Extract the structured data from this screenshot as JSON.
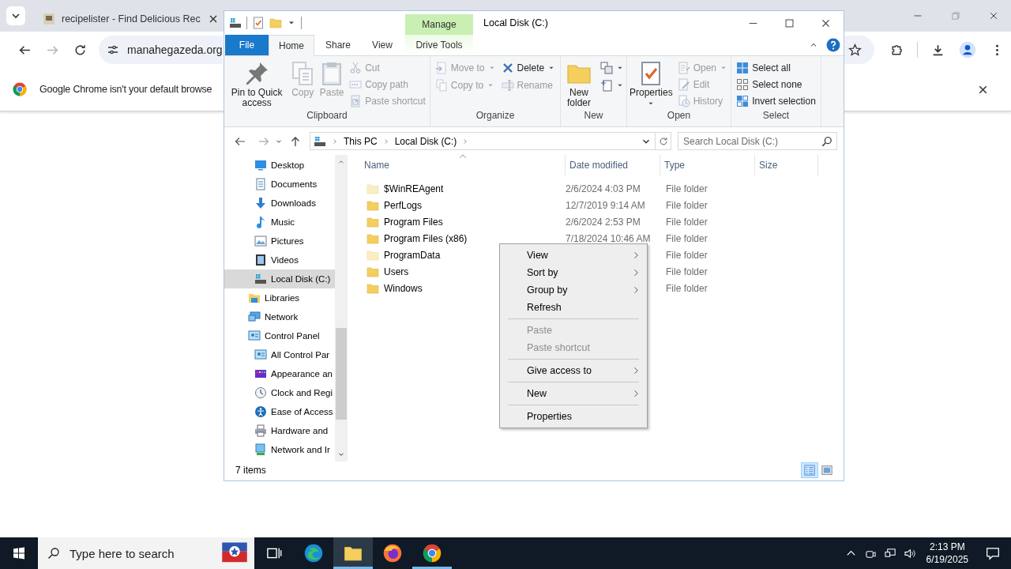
{
  "browser": {
    "tab_title": "recipelister - Find Delicious Rec",
    "url": "manahegazeda.org",
    "infobar_text": "Google Chrome isn't your default browse"
  },
  "explorer": {
    "title": "Local Disk (C:)",
    "contextual_group": "Manage",
    "tabs": [
      {
        "label": "File",
        "kind": "file"
      },
      {
        "label": "Home",
        "kind": "tab",
        "selected": true
      },
      {
        "label": "Share",
        "kind": "tab",
        "selected": false
      },
      {
        "label": "View",
        "kind": "tab",
        "selected": false
      },
      {
        "label": "Drive Tools",
        "kind": "contextual",
        "selected": false
      }
    ],
    "ribbon": {
      "groups": [
        {
          "label": "Clipboard",
          "columns": [
            {
              "buttons": [
                {
                  "label": "Pin to Quick access",
                  "kind": "large",
                  "disabled": false,
                  "dropdown": false
                }
              ]
            },
            {
              "buttons": [
                {
                  "label": "Copy",
                  "kind": "large",
                  "disabled": true,
                  "dropdown": false
                }
              ]
            },
            {
              "buttons": [
                {
                  "label": "Paste",
                  "kind": "large",
                  "disabled": true,
                  "dropdown": false
                }
              ]
            },
            {
              "buttons": [
                {
                  "label": "Cut",
                  "kind": "small",
                  "disabled": true,
                  "dropdown": false
                },
                {
                  "label": "Copy path",
                  "kind": "small",
                  "disabled": true,
                  "dropdown": false
                },
                {
                  "label": "Paste shortcut",
                  "kind": "small",
                  "disabled": true,
                  "dropdown": false
                }
              ]
            }
          ]
        },
        {
          "label": "Organize",
          "columns": [
            {
              "buttons": [
                {
                  "label": "Move to",
                  "kind": "small",
                  "disabled": true,
                  "dropdown": true
                },
                {
                  "label": "Copy to",
                  "kind": "small",
                  "disabled": true,
                  "dropdown": true
                }
              ]
            },
            {
              "buttons": [
                {
                  "label": "Delete",
                  "kind": "small",
                  "disabled": false,
                  "dropdown": true
                },
                {
                  "label": "Rename",
                  "kind": "small",
                  "disabled": true,
                  "dropdown": false
                }
              ]
            }
          ]
        },
        {
          "label": "New",
          "columns": [
            {
              "buttons": [
                {
                  "label": "New folder",
                  "kind": "large",
                  "disabled": false,
                  "dropdown": false
                }
              ]
            },
            {
              "buttons": [
                {
                  "kind": "small",
                  "disabled": false,
                  "dropdown": true
                },
                {
                  "kind": "small",
                  "disabled": false,
                  "dropdown": true
                }
              ]
            }
          ]
        },
        {
          "label": "Open",
          "columns": [
            {
              "buttons": [
                {
                  "label": "Properties",
                  "kind": "large",
                  "disabled": false,
                  "dropdown": true
                }
              ]
            },
            {
              "buttons": [
                {
                  "label": "Open",
                  "kind": "small",
                  "disabled": true,
                  "dropdown": true
                },
                {
                  "label": "Edit",
                  "kind": "small",
                  "disabled": true,
                  "dropdown": false
                },
                {
                  "label": "History",
                  "kind": "small",
                  "disabled": true,
                  "dropdown": false
                }
              ]
            }
          ]
        },
        {
          "label": "Select",
          "columns": [
            {
              "buttons": [
                {
                  "label": "Select all",
                  "kind": "small",
                  "disabled": false,
                  "dropdown": false
                },
                {
                  "label": "Select none",
                  "kind": "small",
                  "disabled": false,
                  "dropdown": false
                },
                {
                  "label": "Invert selection",
                  "kind": "small",
                  "disabled": false,
                  "dropdown": false
                }
              ]
            }
          ]
        }
      ]
    },
    "address": {
      "crumbs": [
        "This PC",
        "Local Disk (C:)"
      ],
      "search_placeholder": "Search Local Disk (C:)"
    },
    "nav": {
      "this_pc_items": [
        {
          "label": "Desktop",
          "selected": false
        },
        {
          "label": "Documents",
          "selected": false
        },
        {
          "label": "Downloads",
          "selected": false
        },
        {
          "label": "Music",
          "selected": false
        },
        {
          "label": "Pictures",
          "selected": false
        },
        {
          "label": "Videos",
          "selected": false
        },
        {
          "label": "Local Disk (C:)",
          "selected": true
        }
      ],
      "items": [
        {
          "label": "Libraries",
          "selected": false
        },
        {
          "label": "Network",
          "selected": false
        },
        {
          "label": "Control Panel",
          "selected": false,
          "children": [
            {
              "label": "All Control Par",
              "selected": false
            },
            {
              "label": "Appearance an",
              "selected": false
            },
            {
              "label": "Clock and Regi",
              "selected": false
            },
            {
              "label": "Ease of Access",
              "selected": false
            },
            {
              "label": "Hardware and",
              "selected": false
            },
            {
              "label": "Network and Ir",
              "selected": false
            }
          ]
        }
      ]
    },
    "columns": [
      {
        "label": "Name",
        "sorted": true
      },
      {
        "label": "Date modified",
        "sorted": false
      },
      {
        "label": "Type",
        "sorted": false
      },
      {
        "label": "Size",
        "sorted": false
      }
    ],
    "files": [
      {
        "name": "$WinREAgent",
        "date": "2/6/2024 4:03 PM",
        "type": "File folder",
        "hidden": true
      },
      {
        "name": "PerfLogs",
        "date": "12/7/2019 9:14 AM",
        "type": "File folder",
        "hidden": false
      },
      {
        "name": "Program Files",
        "date": "2/6/2024 2:53 PM",
        "type": "File folder",
        "hidden": false
      },
      {
        "name": "Program Files (x86)",
        "date": "7/18/2024 10:46 AM",
        "type": "File folder",
        "hidden": false
      },
      {
        "name": "ProgramData",
        "type": "File folder",
        "hidden": true
      },
      {
        "name": "Users",
        "type": "File folder",
        "hidden": false
      },
      {
        "name": "Windows",
        "type": "File folder",
        "hidden": false
      }
    ],
    "status": "7 items",
    "view_modes": [
      {
        "selected": true
      },
      {
        "selected": false
      }
    ]
  },
  "context_menu": {
    "items": [
      {
        "kind": "item",
        "label": "View",
        "submenu": true,
        "disabled": false
      },
      {
        "kind": "item",
        "label": "Sort by",
        "submenu": true,
        "disabled": false
      },
      {
        "kind": "item",
        "label": "Group by",
        "submenu": true,
        "disabled": false
      },
      {
        "kind": "item",
        "label": "Refresh",
        "submenu": false,
        "disabled": false
      },
      {
        "kind": "separator"
      },
      {
        "kind": "item",
        "label": "Paste",
        "submenu": false,
        "disabled": true
      },
      {
        "kind": "item",
        "label": "Paste shortcut",
        "submenu": false,
        "disabled": true
      },
      {
        "kind": "separator"
      },
      {
        "kind": "item",
        "label": "Give access to",
        "submenu": true,
        "disabled": false
      },
      {
        "kind": "separator"
      },
      {
        "kind": "item",
        "label": "New",
        "submenu": true,
        "disabled": false
      },
      {
        "kind": "separator"
      },
      {
        "kind": "item",
        "label": "Properties",
        "submenu": false,
        "disabled": false
      }
    ]
  },
  "taskbar": {
    "search_placeholder": "Type here to search",
    "apps": [
      {
        "active": false,
        "running": false
      },
      {
        "active": true,
        "running": true
      },
      {
        "active": false,
        "running": false
      },
      {
        "active": false,
        "running": true
      }
    ],
    "time": "2:13 PM",
    "date": "6/19/2025"
  }
}
